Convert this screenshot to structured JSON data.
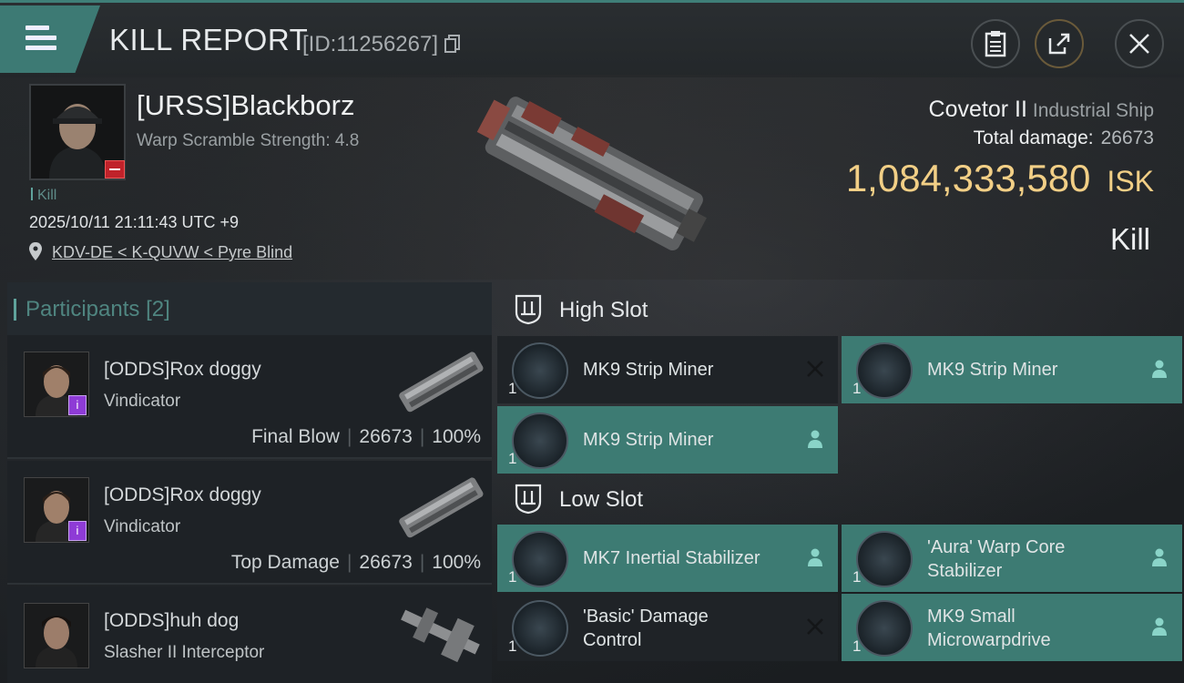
{
  "header": {
    "title": "KILL REPORT",
    "report_id": "[ID:11256267]",
    "icons": [
      "menu-icon",
      "copy-icon",
      "clipboard-icon",
      "share-icon",
      "close-icon"
    ]
  },
  "victim": {
    "name": "[URSS]Blackborz",
    "warp_scramble": "Warp Scramble Strength: 4.8",
    "kill_tag": "Kill",
    "datetime": "2025/10/11 21:11:43 UTC +9",
    "location": "KDV-DE < K-QUVW < Pyre Blind",
    "ship": "Covetor II",
    "ship_class": "Industrial Ship",
    "total_damage_label": "Total damage:",
    "total_damage": "26673",
    "isk_value": "1,084,333,580",
    "isk_unit": "ISK",
    "result": "Kill"
  },
  "participants": {
    "heading": "Participants",
    "count": "[2]",
    "rows": [
      {
        "name": "[ODDS]Rox doggy",
        "ship": "Vindicator",
        "badge": "i",
        "stat_label": "Final Blow",
        "damage": "26673",
        "percent": "100%"
      },
      {
        "name": "[ODDS]Rox doggy",
        "ship": "Vindicator",
        "badge": "i",
        "stat_label": "Top Damage",
        "damage": "26673",
        "percent": "100%"
      },
      {
        "name": "[ODDS]huh dog",
        "ship": "Slasher II Interceptor"
      }
    ]
  },
  "slots": {
    "high": {
      "title": "High Slot",
      "modules": [
        {
          "name": "MK9 Strip Miner",
          "qty": "1",
          "state": "destroyed"
        },
        {
          "name": "MK9 Strip Miner",
          "qty": "1",
          "state": "dropped"
        },
        {
          "name": "MK9 Strip Miner",
          "qty": "1",
          "state": "dropped"
        }
      ]
    },
    "low": {
      "title": "Low Slot",
      "modules": [
        {
          "name": "MK7 Inertial Stabilizer",
          "qty": "1",
          "state": "dropped"
        },
        {
          "name": "'Aura' Warp Core Stabilizer",
          "qty": "1",
          "state": "dropped"
        },
        {
          "name": "'Basic' Damage Control",
          "qty": "1",
          "state": "destroyed"
        },
        {
          "name": "MK9 Small Microwarpdrive",
          "qty": "1",
          "state": "dropped"
        }
      ]
    }
  },
  "colors": {
    "accent": "#3d7b73",
    "isk": "#f2cf86",
    "badge_red": "#c0222a",
    "badge_purple": "#8e3bd6"
  }
}
